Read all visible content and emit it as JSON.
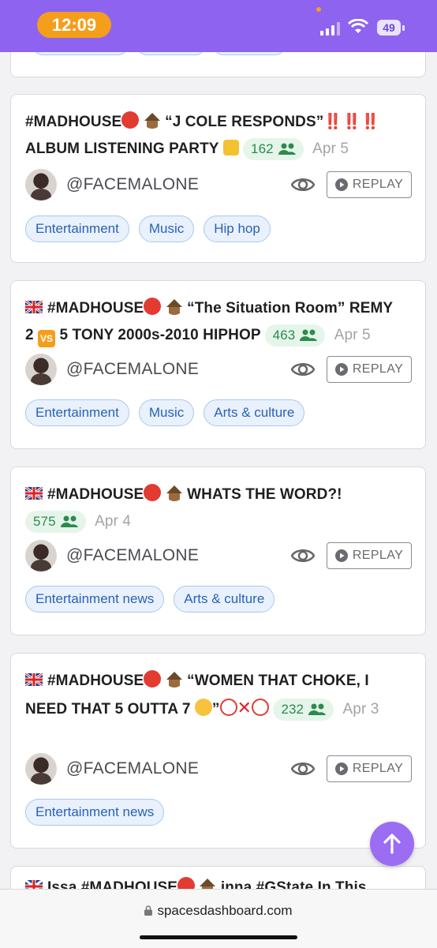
{
  "status_bar": {
    "time": "12:09",
    "battery": "49"
  },
  "browser": {
    "url": "spacesdashboard.com"
  },
  "colors": {
    "accent": "#8e63f0",
    "time_pill": "#f59e1b",
    "tag_bg": "#e8f1fc",
    "listener_bg": "#e5f5ea"
  },
  "feed": {
    "cards": [
      {
        "title_parts": [
          "#MADHOUSE",
          "“J COLE RESPONDS”",
          "‼️‼️‼️",
          "ALBUM LISTENING PARTY"
        ],
        "listeners": "162",
        "date": "Apr 5",
        "host": "@FACEMALONE",
        "replay_label": "REPLAY",
        "tags": [
          "Entertainment",
          "Music",
          "Hip hop"
        ]
      },
      {
        "title_parts": [
          "#MADHOUSE",
          "“The Situation Room” REMY",
          "2",
          "5 TONY 2000s-2010 HIPHOP"
        ],
        "vs": "VS",
        "listeners": "463",
        "date": "Apr 5",
        "host": "@FACEMALONE",
        "replay_label": "REPLAY",
        "tags": [
          "Entertainment",
          "Music",
          "Arts & culture"
        ]
      },
      {
        "title_parts": [
          "#MADHOUSE",
          "WHATS THE WORD?!"
        ],
        "listeners": "575",
        "date": "Apr 4",
        "host": "@FACEMALONE",
        "replay_label": "REPLAY",
        "tags": [
          "Entertainment news",
          "Arts & culture"
        ]
      },
      {
        "title_parts": [
          "#MADHOUSE",
          "“WOMEN THAT CHOKE, I",
          "NEED THAT 5 OUTTA 7",
          "”"
        ],
        "listeners": "232",
        "date": "Apr 3",
        "host": "@FACEMALONE",
        "replay_label": "REPLAY",
        "tags": [
          "Entertainment news"
        ]
      },
      {
        "title_parts": [
          "Issa #MADHOUSE",
          "inna #GState In This"
        ]
      }
    ]
  }
}
